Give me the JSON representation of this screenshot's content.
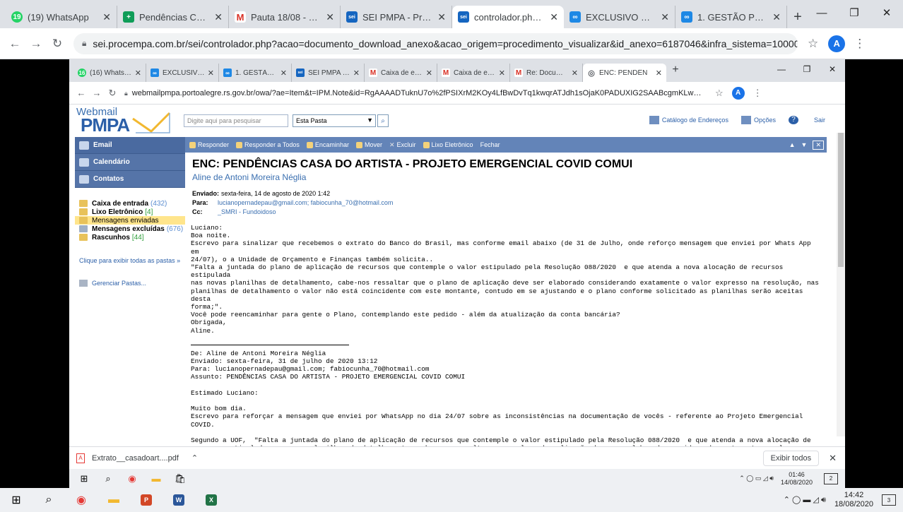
{
  "outer": {
    "tabs": [
      {
        "label": "(19) WhatsApp",
        "color": "#25d366",
        "glyph": "19"
      },
      {
        "label": "Pendências CONS",
        "color": "#0f9d58",
        "glyph": "+"
      },
      {
        "label": "Pauta 18/08 - ope",
        "color": "#d93025",
        "glyph": "M"
      },
      {
        "label": "SEI PMPA - Proce",
        "color": "#1565c0",
        "glyph": "sei"
      },
      {
        "label": "controlador.php (1",
        "color": "#1565c0",
        "glyph": "sei"
      },
      {
        "label": "EXCLUSIVO COMU",
        "color": "#1e88e5",
        "glyph": "∞"
      },
      {
        "label": "1. GESTÃO PLENO",
        "color": "#1e88e5",
        "glyph": "∞"
      }
    ],
    "url": "sei.procempa.com.br/sei/controlador.php?acao=documento_download_anexo&acao_origem=procedimento_visualizar&id_anexo=6187046&infra_sistema=100000093&infra_uni...",
    "avatar": "A"
  },
  "inner": {
    "tabs": [
      {
        "label": "(16) WhatsApp",
        "color": "#25d366",
        "glyph": "16"
      },
      {
        "label": "EXCLUSIVO CC",
        "color": "#1e88e5",
        "glyph": "∞"
      },
      {
        "label": "1. GESTÃO PLE",
        "color": "#1e88e5",
        "glyph": "∞"
      },
      {
        "label": "SEI PMPA - Pr",
        "color": "#1565c0",
        "glyph": "sei"
      },
      {
        "label": "Caixa de entra",
        "color": "#d93025",
        "glyph": "M"
      },
      {
        "label": "Caixa de entra",
        "color": "#d93025",
        "glyph": "M"
      },
      {
        "label": "Re: Document",
        "color": "#d93025",
        "glyph": "M"
      },
      {
        "label": "ENC: PENDÊN",
        "color": "#5f6368",
        "glyph": "◎"
      }
    ],
    "url": "webmailpmpa.portoalegre.rs.gov.br/owa/?ae=Item&t=IPM.Note&id=RgAAAADTuknU7o%2fPSIXrM2KOy4LfBwDvTq1kwqrATJdh1sOjaK0PADUXIG2SAABcgmKLw%2b1yRpKW8QD...",
    "avatar": "A"
  },
  "owa": {
    "logo_top": "Webmail",
    "logo_main": "PMPA",
    "search_placeholder": "Digite aqui para pesquisar",
    "scope": "Esta Pasta",
    "links": [
      "Catálogo de Endereços",
      "Opções",
      "Sair"
    ],
    "nav": [
      "Email",
      "Calendário",
      "Contatos"
    ],
    "folders": [
      {
        "label": "Caixa de entrada",
        "count": "(432)",
        "bold": true
      },
      {
        "label": "Lixo Eletrônico",
        "count": "[4]",
        "bold": true
      },
      {
        "label": "Mensagens enviadas",
        "count": "",
        "bold": false
      },
      {
        "label": "Mensagens excluídas",
        "count": "(676)",
        "bold": true
      },
      {
        "label": "Rascunhos",
        "count": "[44]",
        "bold": true
      }
    ],
    "show_all": "Clique para exibir todas as pastas »",
    "manage": "Gerenciar Pastas...",
    "toolbar": [
      "Responder",
      "Responder a Todos",
      "Encaminhar",
      "Mover",
      "Excluir",
      "Lixo Eletrônico",
      "Fechar"
    ]
  },
  "message": {
    "subject": "ENC: PENDÊNCIAS CASA DO ARTISTA - PROJETO EMERGENCIAL COVID COMUI",
    "from": "Aline de Antoni Moreira Néglia",
    "sent_label": "Enviado:",
    "sent": "sexta-feira, 14 de agosto de 2020 1:42",
    "to_label": "Para:",
    "to": "lucianopernadepau@gmail.com; fabiocunha_70@hotmail.com",
    "cc_label": "Cc:",
    "cc": "_SMRI - Fundoidoso",
    "body1": "Luciano:\nBoa noite.\nEscrevo para sinalizar que recebemos o extrato do Banco do Brasil, mas conforme email abaixo (de 31 de Julho, onde reforço mensagem que enviei por Whats App em\n24/07), o a Unidade de Orçamento e Finanças também solicita..\n\"Falta a juntada do plano de aplicação de recursos que contemple o valor estipulado pela Resolução 088/2020  e que atenda a nova alocação de recursos estipulada\nnas novas planilhas de detalhamento, cabe-nos ressaltar que o plano de aplicação deve ser elaborado considerando exatamente o valor expresso na resolução, nas\nplanilhas de detalhamento o valor não está coincidente com este montante, contudo em se ajustando e o plano conforme solicitado as planilhas serão aceitas desta\nforma;\".\nVocê pode reencaminhar para gente o Plano, contemplando este pedido - além da atualização da conta bancária?\nObrigada,\nAline.",
    "body2": "De: Aline de Antoni Moreira Néglia\nEnviado: sexta-feira, 31 de julho de 2020 13:12\nPara: lucianopernadepau@gmail.com; fabiocunha_70@hotmail.com\nAssunto: PENDÊNCIAS CASA DO ARTISTA - PROJETO EMERGENCIAL COVID COMUI\n\nEstimado Luciano:\n\nMuito bom dia.\nEscrevo para reforçar a mensagem que enviei por WhatsApp no dia 24/07 sobre as inconsistências na documentação de vocês - referente ao Projeto Emergencial COVID.\n\nSegundo a UOF,  \"Falta a juntada do plano de aplicação de recursos que contemple o valor estipulado pela Resolução 088/2020  e que atenda a nova alocação de\nrecursos estipulada nas novas planilhas de detalhamento, cabe-nos ressaltar que o plano de aplicação deve ser elaborado considerando exatamente o valor expresso\nna resolução, nas planilhas de detalhamento o valor não está coincidente com este montante, contudo em se ajustando e o plano conforme solicitado as planilhas"
  },
  "download": {
    "file": "Extrato__casadoart....pdf",
    "show_all": "Exibir todos"
  },
  "inner_clock": {
    "time": "01:46",
    "date": "14/08/2020",
    "badge": "2"
  },
  "outer_clock": {
    "time": "14:42",
    "date": "18/08/2020",
    "badge": "3"
  }
}
